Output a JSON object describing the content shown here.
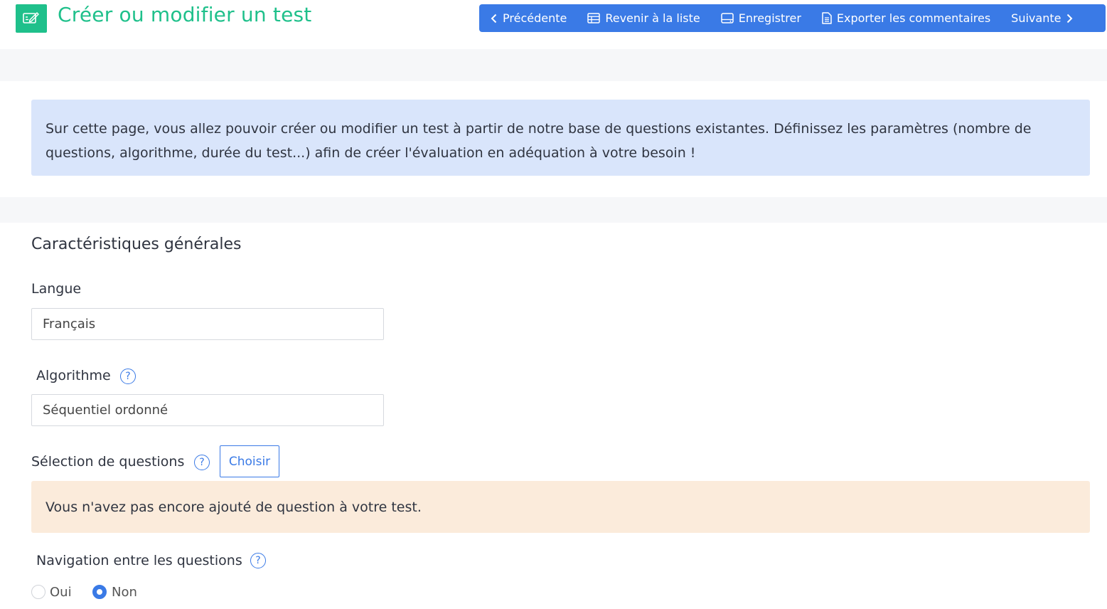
{
  "header": {
    "title": "Créer ou modifier un test",
    "app_icon": "edit-note-icon",
    "accent_color": "#1fc08b"
  },
  "toolbar": {
    "color": "#3a7ae6",
    "previous_label": "Précédente",
    "back_to_list_label": "Revenir à la liste",
    "save_label": "Enregistrer",
    "export_comments_label": "Exporter les commentaires",
    "next_label": "Suivante"
  },
  "info": {
    "text": "Sur cette page, vous allez pouvoir créer ou modifier un test à partir de notre base de questions existantes. Définissez les paramètres (nombre de questions, algorithme, durée du test...) afin de créer l'évaluation en adéquation à votre besoin !"
  },
  "general": {
    "section_title": "Caractéristiques générales",
    "language": {
      "label": "Langue",
      "value": "Français"
    },
    "algorithm": {
      "label": "Algorithme",
      "value": "Séquentiel ordonné"
    },
    "question_selection": {
      "label": "Sélection de questions",
      "button_label": "Choisir"
    },
    "no_question_warning": "Vous n'avez pas encore ajouté de question à votre test.",
    "navigation": {
      "label": "Navigation entre les questions",
      "options": [
        "Oui",
        "Non"
      ],
      "selected": "Non"
    },
    "help_glyph": "?"
  }
}
